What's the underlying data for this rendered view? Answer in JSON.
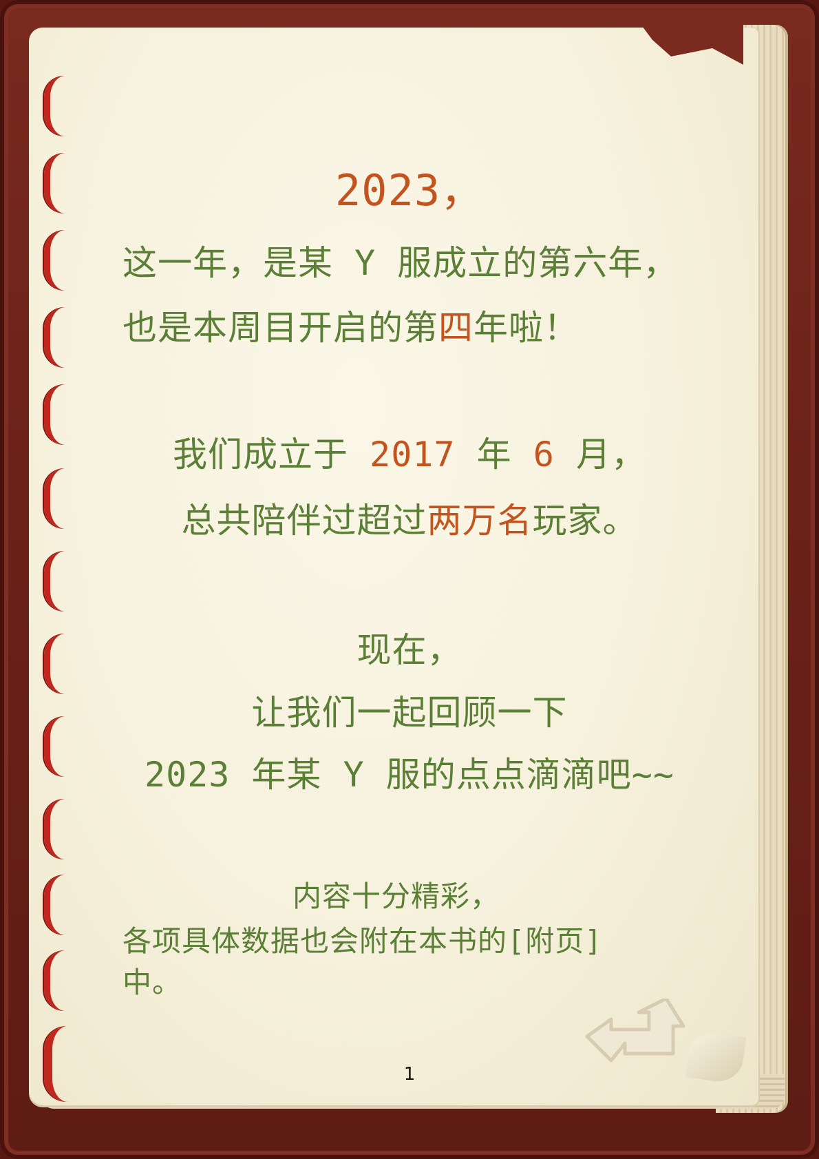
{
  "page": {
    "title_year": "2023，",
    "intro": {
      "line1": "这一年，是某 Y 服成立的第六年，",
      "line2_a": "也是本周目开启的第",
      "line2_hl": "四",
      "line2_b": "年啦！"
    },
    "founding": {
      "line1_a": "我们成立于 ",
      "line1_year": "2017",
      "line1_b": " 年 ",
      "line1_month": "6",
      "line1_c": " 月，",
      "line2_a": "总共陪伴过超过",
      "line2_hl": "两万名",
      "line2_b": "玩家。"
    },
    "review": {
      "line1": "现在，",
      "line2": "让我们一起回顾一下",
      "line3": "2023 年某 Y 服的点点滴滴吧~~"
    },
    "note": {
      "line1": "内容十分精彩，",
      "line2": "各项具体数据也会附在本书的[附页]",
      "line3": "中。"
    },
    "page_number": "1"
  },
  "colors": {
    "text_green": "#5b7f36",
    "highlight_orange": "#c2541f",
    "frame_red": "#7a2a1f",
    "ring_red": "#c0281f",
    "paper": "#f6f1dc"
  },
  "icons": {
    "next_page": "next-page-arrow-icon"
  }
}
